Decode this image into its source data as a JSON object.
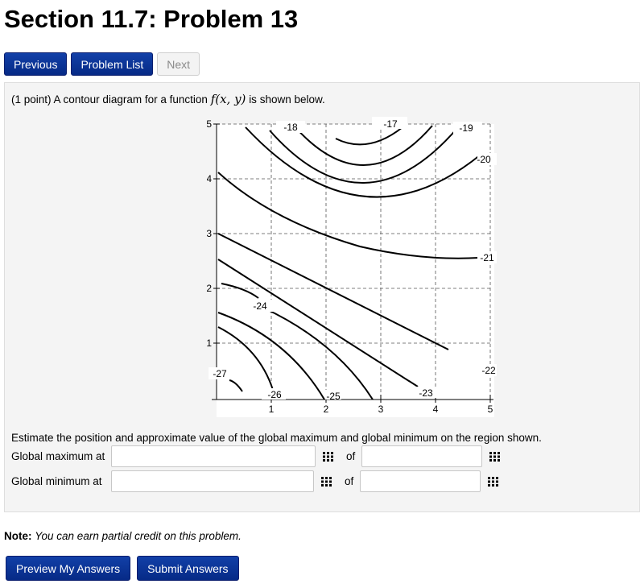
{
  "page": {
    "title": "Section 11.7: Problem 13"
  },
  "nav": {
    "previous": "Previous",
    "problem_list": "Problem List",
    "next": "Next"
  },
  "problem": {
    "points": "(1 point)",
    "intro_text": "A contour diagram for a function",
    "function_notation": "f(x, y)",
    "intro_suffix": "is shown below.",
    "estimate_text": "Estimate the position and approximate value of the global maximum and global minimum on the region shown.",
    "max_label": "Global maximum at",
    "min_label": "Global minimum at",
    "of_label": "of",
    "max_position_value": "",
    "max_value": "",
    "min_position_value": "",
    "min_value": ""
  },
  "contour_plot": {
    "x_ticks": [
      "1",
      "2",
      "3",
      "4",
      "5"
    ],
    "y_ticks": [
      "1",
      "2",
      "3",
      "4",
      "5"
    ],
    "contour_labels": [
      "-17",
      "-18",
      "-19",
      "-20",
      "-21",
      "-22",
      "-23",
      "-24",
      "-25",
      "-26",
      "-27"
    ],
    "grid": "dashed"
  },
  "note": {
    "label": "Note:",
    "text": "You can earn partial credit on this problem."
  },
  "actions": {
    "preview": "Preview My Answers",
    "submit": "Submit Answers"
  },
  "colors": {
    "button_blue": "#062a86",
    "panel_bg": "#f4f4f4"
  }
}
